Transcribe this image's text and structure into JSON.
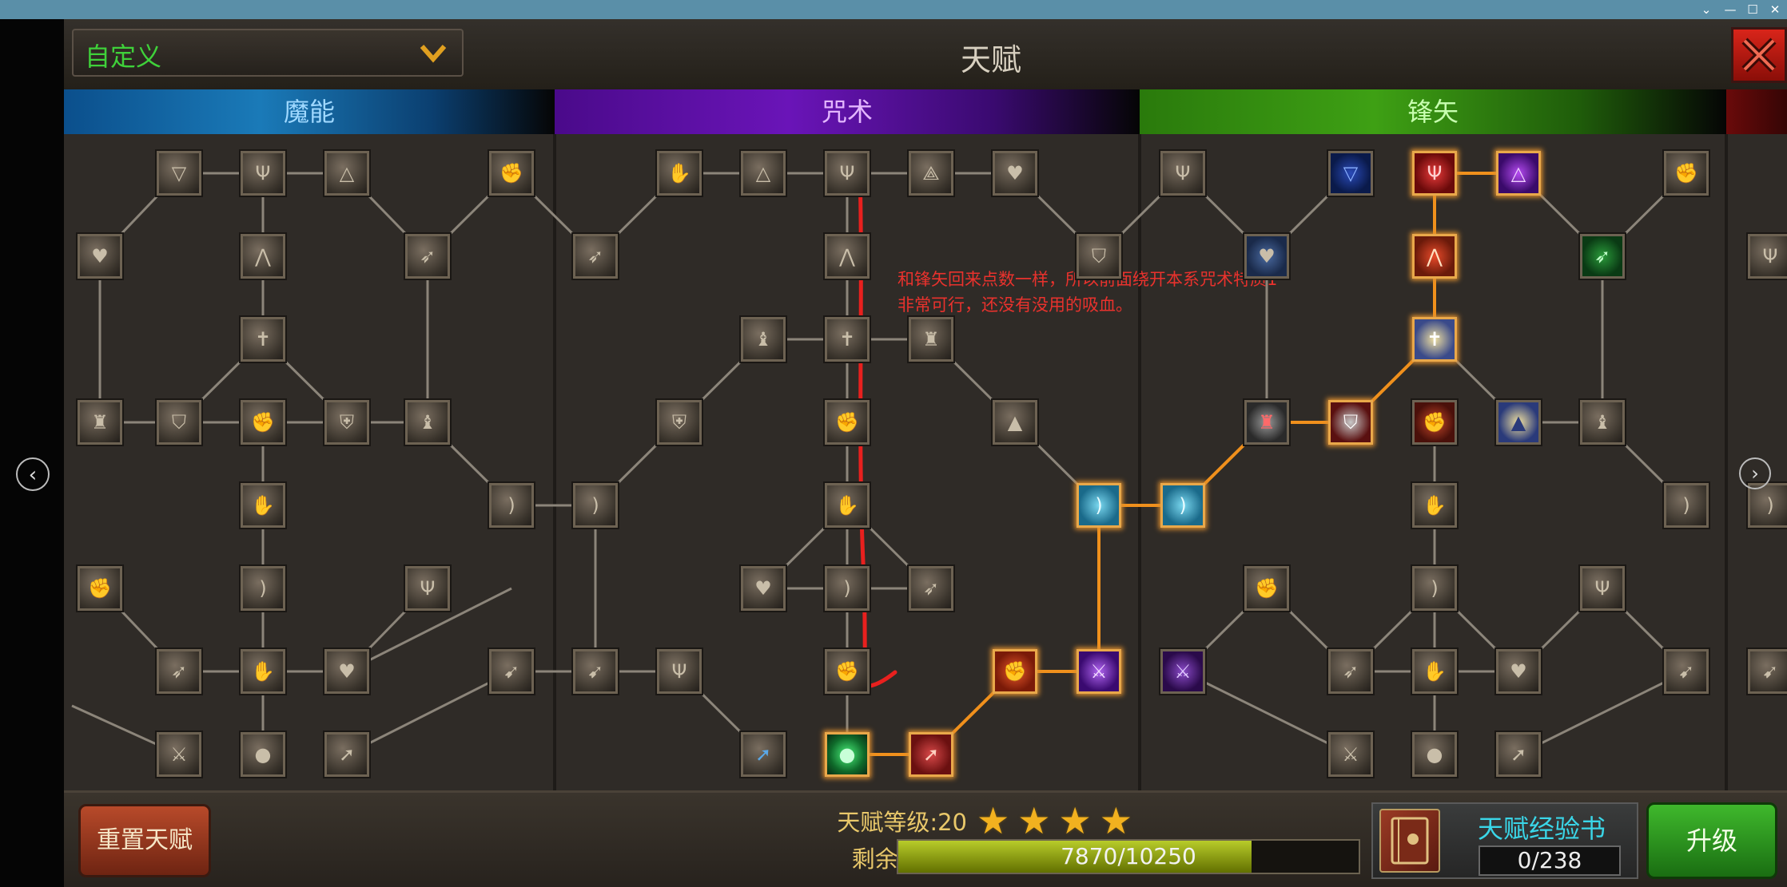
{
  "window": {
    "minimize": "—",
    "maximize": "☐",
    "close": "✕"
  },
  "header": {
    "dropdown_label": "自定义",
    "title": "天赋"
  },
  "tabs": [
    {
      "id": "mana",
      "label": "魔能"
    },
    {
      "id": "curse",
      "label": "咒术"
    },
    {
      "id": "arrow",
      "label": "锋矢"
    }
  ],
  "annotation": {
    "line1": "和锋矢回来点数一样，所以前面绕开本系咒术特质1",
    "line2": "非常可行，还没有没用的吸血。"
  },
  "footer": {
    "reset_label": "重置天赋",
    "level_label": "天赋等级:20",
    "points_label": "剩余点数:4",
    "stars": 4,
    "xp_text": "7870/10250",
    "xp_current": 7870,
    "xp_max": 10250,
    "book_title": "天赋经验书",
    "book_count": "0/238",
    "upgrade_label": "升级"
  },
  "colors": {
    "mana_tab": "#1a7ab8",
    "curse_tab": "#6a14b8",
    "arrow_tab": "#3ea014",
    "active_link": "#f0901c",
    "annotation": "#e9322d",
    "dropdown_text": "#3fd13a"
  }
}
